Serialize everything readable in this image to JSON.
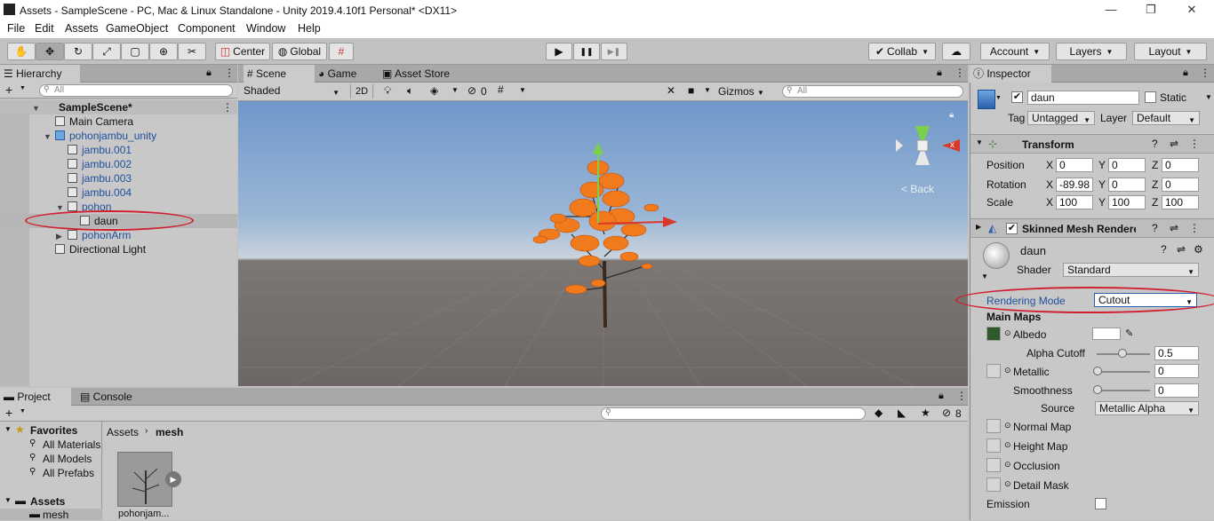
{
  "window": {
    "title": "Assets - SampleScene - PC, Mac & Linux Standalone - Unity 2019.4.10f1 Personal* <DX11>",
    "minimize": "—",
    "maximize": "❐",
    "close": "✕"
  },
  "menu": [
    "File",
    "Edit",
    "Assets",
    "GameObject",
    "Component",
    "Window",
    "Help"
  ],
  "toolbar": {
    "pivot": "Center",
    "space": "Global",
    "collab": "Collab",
    "account": "Account",
    "layers": "Layers",
    "layout": "Layout",
    "play": "▶",
    "pause": "❚❚",
    "step": "▶❚"
  },
  "hierarchy": {
    "tab": "Hierarchy",
    "search_placeholder": "All",
    "add": "+",
    "rows": [
      {
        "label": "SampleScene*",
        "bold": true
      },
      {
        "label": "Main Camera"
      },
      {
        "label": "pohonjambu_unity"
      },
      {
        "label": "jambu.001"
      },
      {
        "label": "jambu.002"
      },
      {
        "label": "jambu.003"
      },
      {
        "label": "jambu.004"
      },
      {
        "label": "pohon"
      },
      {
        "label": "daun"
      },
      {
        "label": "pohonArm"
      },
      {
        "label": "Directional Light"
      }
    ]
  },
  "scene": {
    "tabs": [
      "Scene",
      "Game",
      "Asset Store"
    ],
    "shading": "Shaded",
    "mode2d": "2D",
    "hidden_count": "0",
    "gizmos": "Gizmos",
    "search_placeholder": "All",
    "gizmo_axis_x": "x",
    "back_label": "< Back"
  },
  "inspector": {
    "tab": "Inspector",
    "object_name": "daun",
    "static_label": "Static",
    "tag_label": "Tag",
    "tag_value": "Untagged",
    "layer_label": "Layer",
    "layer_value": "Default",
    "transform": {
      "title": "Transform",
      "position_label": "Position",
      "rotation_label": "Rotation",
      "scale_label": "Scale",
      "axis": [
        "X",
        "Y",
        "Z"
      ],
      "position": [
        "0",
        "0",
        "0"
      ],
      "rotation": [
        "-89.98",
        "0",
        "0"
      ],
      "scale": [
        "100",
        "100",
        "100"
      ]
    },
    "renderer": {
      "title": "Skinned Mesh Renderer"
    },
    "material": {
      "name": "daun",
      "shader_label": "Shader",
      "shader_value": "Standard",
      "rendering_mode_label": "Rendering Mode",
      "rendering_mode_value": "Cutout",
      "main_maps": "Main Maps",
      "albedo": "Albedo",
      "alpha_cutoff_label": "Alpha Cutoff",
      "alpha_cutoff": "0.5",
      "metallic_label": "Metallic",
      "metallic": "0",
      "smoothness_label": "Smoothness",
      "smoothness": "0",
      "source_label": "Source",
      "source_value": "Metallic Alpha",
      "normal_map": "Normal Map",
      "height_map": "Height Map",
      "occlusion": "Occlusion",
      "detail_mask": "Detail Mask",
      "emission": "Emission"
    }
  },
  "project": {
    "tabs": [
      "Project",
      "Console"
    ],
    "favorites": "Favorites",
    "favorite_items": [
      "All Materials",
      "All Models",
      "All Prefabs"
    ],
    "assets": "Assets",
    "mesh_folder": "mesh",
    "breadcrumb": [
      "Assets",
      "mesh"
    ],
    "asset_items": [
      {
        "label": "pohonjam..."
      }
    ],
    "hidden_count": "8"
  },
  "colors": {
    "annotation": "#d01f2e",
    "selection": "#b8b8b8",
    "leaf_orange": "#f07a1c"
  }
}
